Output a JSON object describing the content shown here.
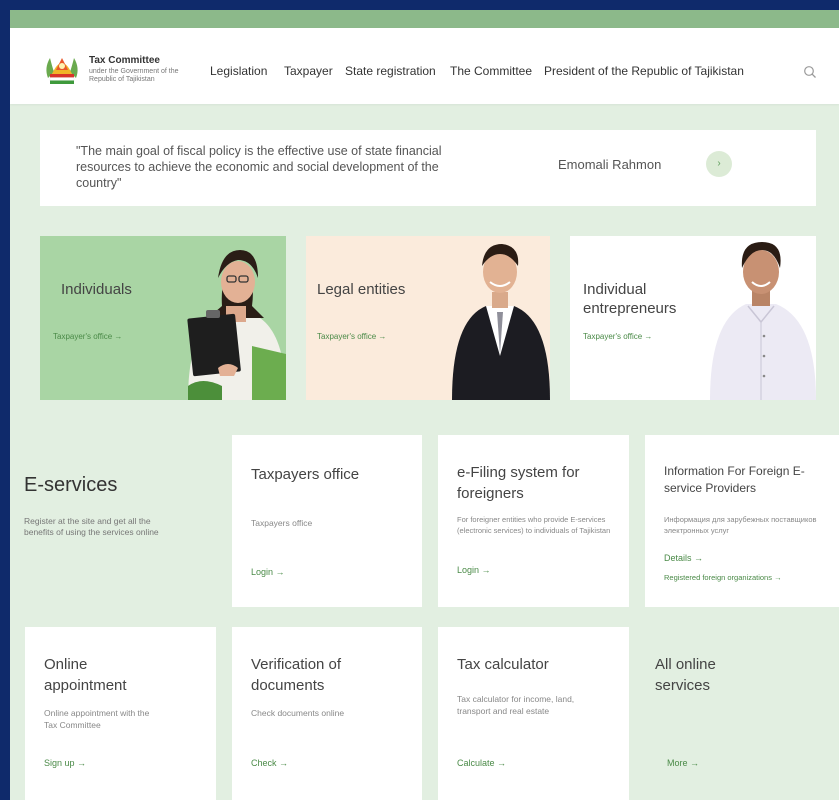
{
  "header": {
    "brand_title": "Tax Committee",
    "brand_subtitle": "under the Government of the Republic of Tajikistan",
    "nav": [
      "Legislation",
      "Taxpayer",
      "State registration",
      "The Committee",
      "President of the Republic of Tajikistan"
    ]
  },
  "quote": {
    "text": "\"The main goal of fiscal policy is the effective use of state financial resources to achieve the economic and social development of the country\"",
    "author": "Emomali Rahmon",
    "next_icon": "›"
  },
  "categories": [
    {
      "title": "Individuals",
      "link": "Taxpayer's office →"
    },
    {
      "title": "Legal entities",
      "link": "Taxpayer's office →"
    },
    {
      "title": "Individual entrepreneurs",
      "link": "Taxpayer's office →"
    }
  ],
  "eservices": {
    "title": "E-services",
    "description": "Register at the site and get all the benefits of using the services online"
  },
  "cards": [
    {
      "title": "Taxpayers office",
      "desc": "Taxpayers office",
      "link": "Login →"
    },
    {
      "title": "e-Filing system for foreigners",
      "desc": "For foreigner entities who provide E-services (electronic services) to individuals of Tajikistan",
      "link": "Login →"
    },
    {
      "title": "Information For Foreign E-service Providers",
      "desc": "Информация для зарубежных поставщиков электронных услуг",
      "link": "Details →",
      "link2": "Registered foreign organizations →"
    },
    {
      "title": "Online appointment",
      "desc": "Online appointment with the Tax Committee",
      "link": "Sign up →"
    },
    {
      "title": "Verification of documents",
      "desc": "Check documents online",
      "link": "Check →"
    },
    {
      "title": "Tax calculator",
      "desc": "Tax calculator for income, land, transport and real estate",
      "link": "Calculate →"
    },
    {
      "title": "All online services",
      "link": "More →"
    }
  ],
  "colors": {
    "page_bg": "#e2efe1",
    "accent_green": "#4a8a47",
    "top_band": "#8cb98a",
    "outer_bg": "#0f2a6b",
    "individuals_bg": "#a9d5a4",
    "legal_bg": "#fbebdc"
  },
  "icons": [
    "tajikistan-emblem-icon",
    "search-icon",
    "arrow-right-icon"
  ]
}
